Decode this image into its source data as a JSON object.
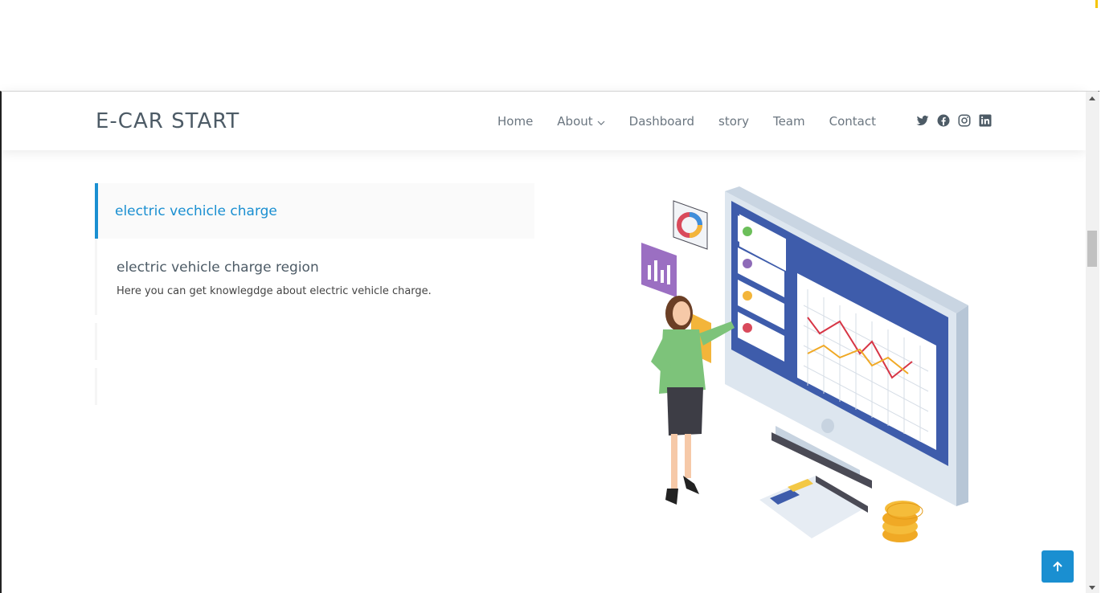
{
  "header": {
    "logo": "E-CAR START",
    "nav": [
      {
        "label": "Home"
      },
      {
        "label": "About"
      },
      {
        "label": "Dashboard"
      },
      {
        "label": "story"
      },
      {
        "label": "Team"
      },
      {
        "label": "Contact"
      }
    ],
    "socials": [
      "twitter-icon",
      "facebook-icon",
      "instagram-icon",
      "linkedin-icon"
    ]
  },
  "accordion": {
    "active_title": "electric vechicle charge",
    "panel_title": "electric vehicle charge region",
    "panel_text": "Here you can get knowlegdge about electric vehicle charge."
  },
  "colors": {
    "accent": "#1a8fd1",
    "logo_text": "#4d5b66",
    "nav_text": "#6b7680"
  },
  "back_to_top_icon": "arrow-up-icon"
}
